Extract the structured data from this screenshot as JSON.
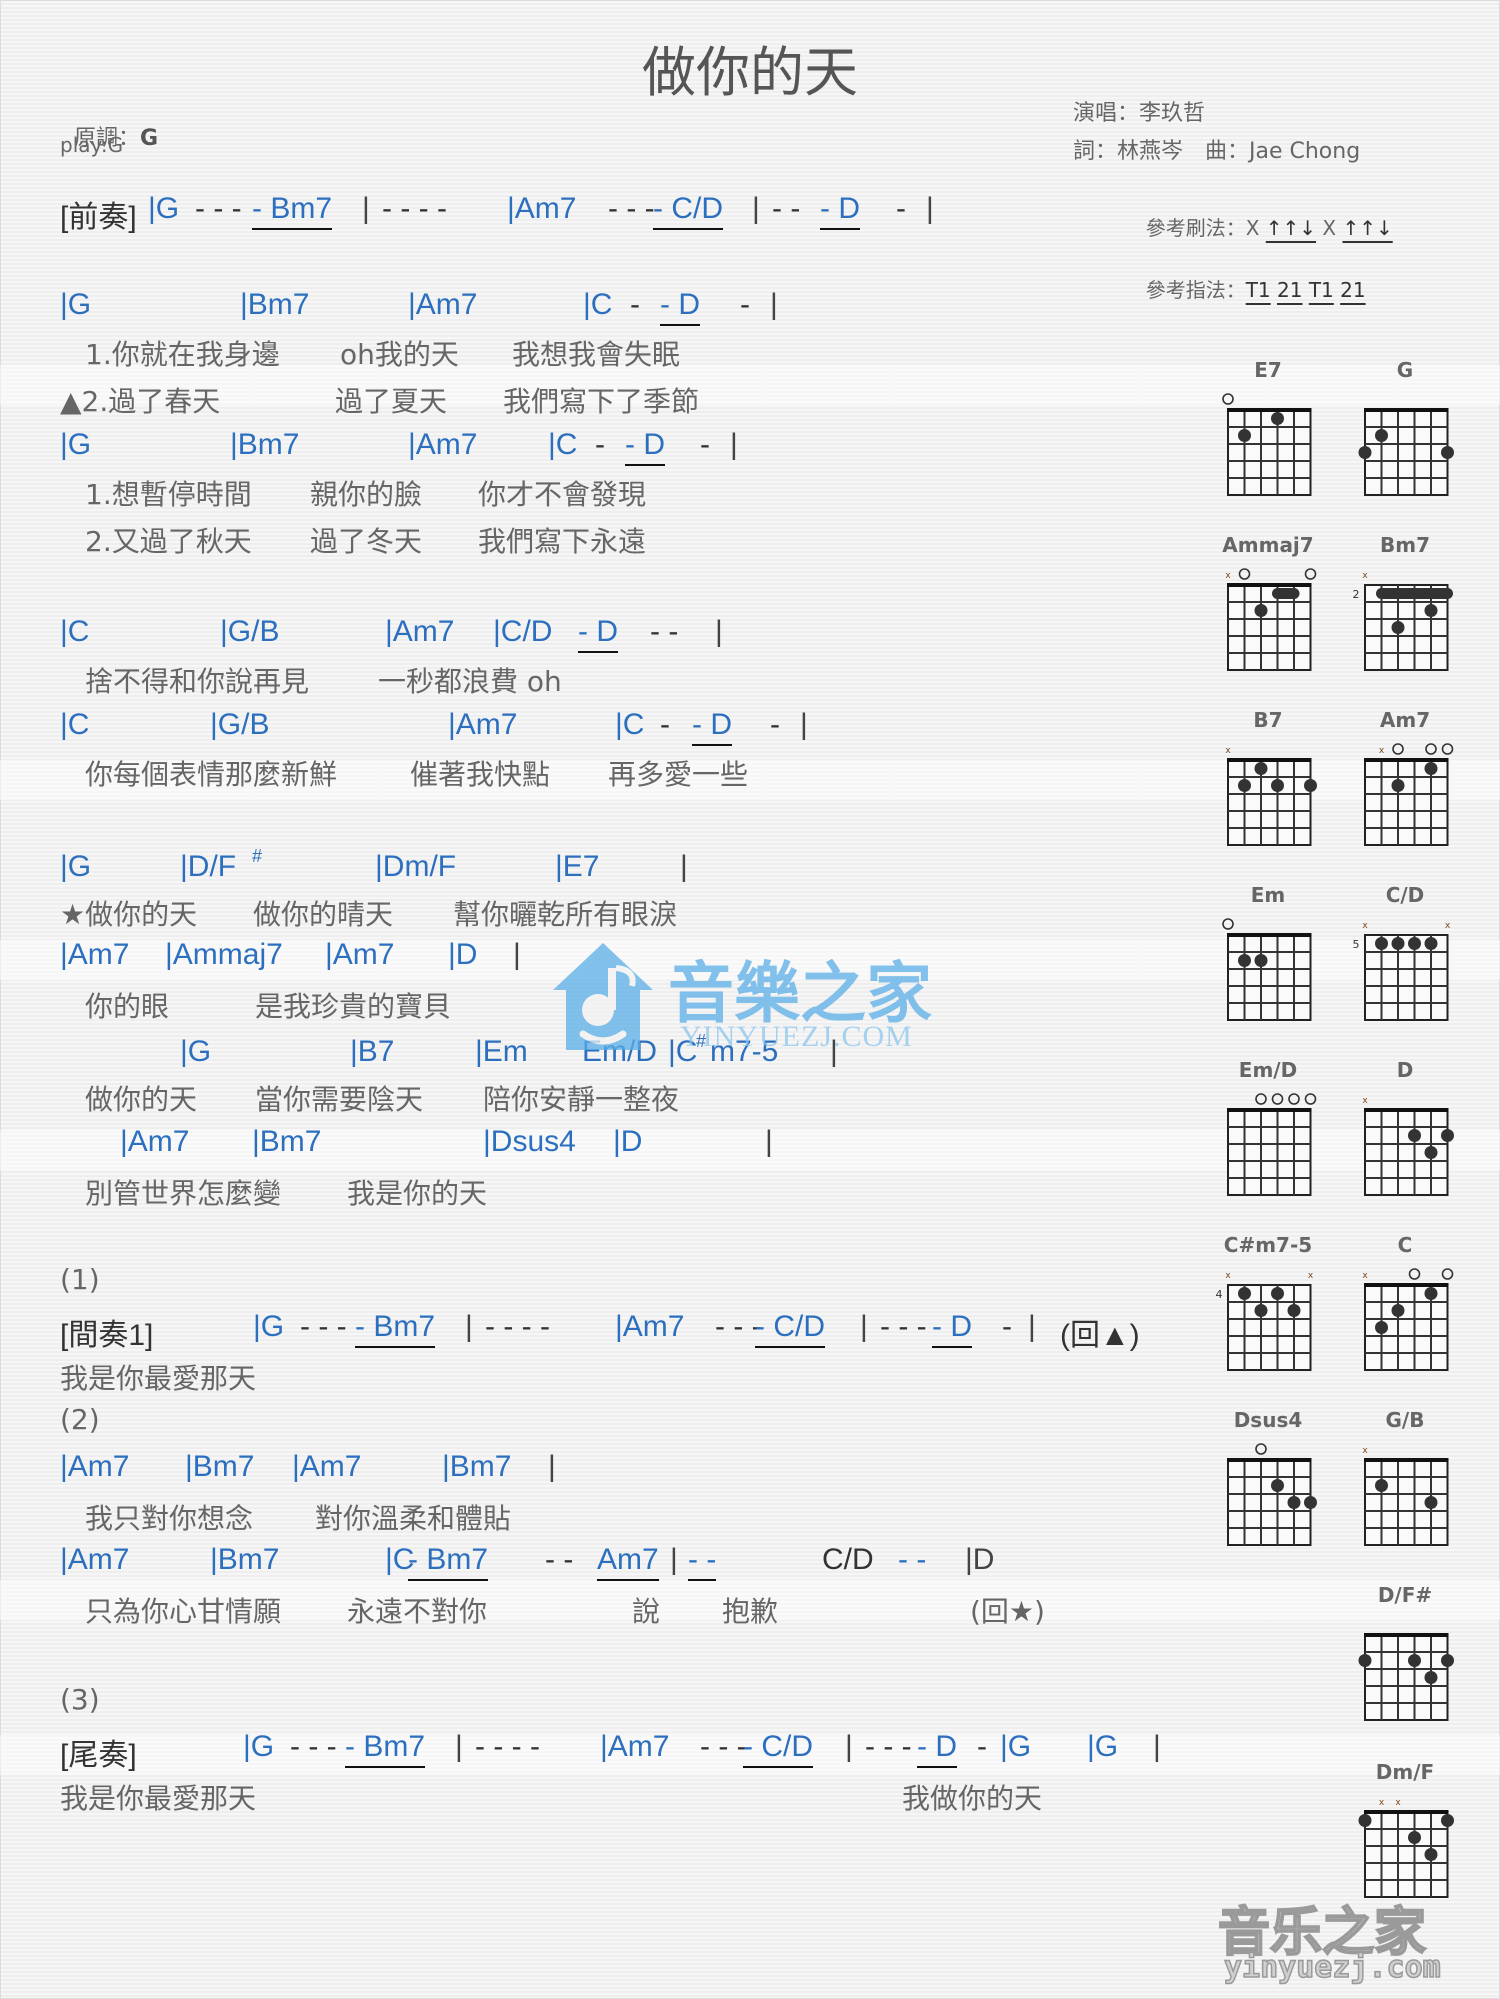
{
  "title": "做你的天",
  "meta": {
    "key_label": "原調：",
    "key_value": "G",
    "play": "play:G",
    "singer": "演唱：李玖哲",
    "credits": "詞：林燕岑　曲：Jae Chong",
    "strum_label": "參考刷法：",
    "strum_parts": [
      "X",
      "↑↑↓",
      "X",
      "↑↑↓"
    ],
    "finger_label": "參考指法：",
    "finger_parts": [
      "T1",
      "21",
      "T1",
      "21"
    ]
  },
  "sections": {
    "intro_label": "[前奏]",
    "interlude_label": "[間奏1]",
    "outro_label": "[尾奏]",
    "part1": "(1)",
    "part2": "(2)",
    "part3": "(3)",
    "back_triangle": "(回▲)",
    "back_star": "(回★)"
  },
  "lines": {
    "intro": [
      "|G",
      "- - -",
      "- Bm7",
      "|",
      "- - - -",
      "|Am7",
      "- - -",
      "- C/D",
      "|",
      "- -",
      "- D",
      "-",
      "|"
    ],
    "v1_chords": [
      "|G",
      "|Bm7",
      "|Am7",
      "|C",
      "-",
      "- D",
      "-",
      "|"
    ],
    "v1_lyric1": [
      "1.你就在我身邊",
      "oh我的天",
      "我想我會失眠"
    ],
    "v1_lyric2": [
      "▲2.過了春天",
      "過了夏天",
      "我們寫下了季節"
    ],
    "v2_chords": [
      "|G",
      "|Bm7",
      "|Am7",
      "|C",
      "-",
      "- D",
      "-",
      "|"
    ],
    "v2_lyric1": [
      "1.想暫停時間",
      "親你的臉",
      "你才不會發現"
    ],
    "v2_lyric2": [
      "2.又過了秋天",
      "過了冬天",
      "我們寫下永遠"
    ],
    "p1_chords": [
      "|C",
      "|G/B",
      "|Am7",
      "|C/D",
      "- D",
      "- -",
      "|"
    ],
    "p1_lyric": [
      "捨不得和你說再見",
      "一秒都浪費 oh"
    ],
    "p2_chords": [
      "|C",
      "|G/B",
      "|Am7",
      "|C",
      "-",
      "- D",
      "-",
      "|"
    ],
    "p2_lyric": [
      "你每個表情那麼新鮮",
      "催著我快點",
      "再多愛一些"
    ],
    "c1_chords": [
      "|G",
      "|D/F",
      "#",
      "|Dm/F",
      "|E7",
      "|"
    ],
    "c1_lyric": [
      "★做你的天",
      "做你的晴天",
      "幫你曬乾所有眼淚"
    ],
    "c2_chords": [
      "|Am7",
      "|Ammaj7",
      "|Am7",
      "|D",
      "|"
    ],
    "c2_lyric": [
      "你的眼",
      "是我珍貴的寶貝"
    ],
    "c3_chords": [
      "|G",
      "|B7",
      "|Em",
      "Em/D",
      "|C",
      "#",
      "m7-5",
      "|"
    ],
    "c3_lyric": [
      "做你的天",
      "當你需要陰天",
      "陪你安靜一整夜"
    ],
    "c4_chords": [
      "|Am7",
      "|Bm7",
      "|Dsus4",
      "|D",
      "|"
    ],
    "c4_lyric": [
      "別管世界怎麼變",
      "我是你的天"
    ],
    "interlude": [
      "|G",
      "- - -",
      "- Bm7",
      "|",
      "- - - -",
      "|Am7",
      "- - -",
      "- C/D",
      "|",
      "- - -",
      "- D",
      "-",
      "|"
    ],
    "interlude_lyric": "我是你最愛那天",
    "b1_chords": [
      "|Am7",
      "|Bm7",
      "|Am7",
      "|Bm7",
      "|"
    ],
    "b1_lyric": [
      "我只對你想念",
      "對你溫柔和體貼"
    ],
    "b2_chords": [
      "|Am7",
      "|Bm7",
      "|C",
      "- Bm7",
      "- -",
      "Am7",
      "|",
      "- -",
      "C/D",
      "- -",
      "|D",
      "|"
    ],
    "b2_lyric": [
      "只為你心甘情願",
      "永遠不對你",
      "說",
      "抱歉"
    ],
    "outro": [
      "|G",
      "- - -",
      "- Bm7",
      "|",
      "- - - -",
      "|Am7",
      "- - -",
      "- C/D",
      "|",
      "- - -",
      "- D",
      "-",
      "|G",
      "|G",
      "|"
    ],
    "outro_lyric": [
      "我是你最愛那天",
      "我做你的天"
    ]
  },
  "chord_diagrams": [
    {
      "name": "E7",
      "base_fret": null,
      "strings": [
        "o",
        "",
        "",
        "",
        "",
        ""
      ],
      "dots": [
        [
          2,
          2
        ],
        [
          4,
          1
        ]
      ],
      "barre": null
    },
    {
      "name": "G",
      "base_fret": null,
      "strings": [
        "",
        "",
        "",
        "",
        "",
        ""
      ],
      "dots": [
        [
          1,
          3
        ],
        [
          2,
          2
        ],
        [
          6,
          3
        ]
      ],
      "barre": null
    },
    {
      "name": "Ammaj7",
      "base_fret": null,
      "strings": [
        "x",
        "o",
        "",
        "",
        "",
        "o"
      ],
      "dots": [
        [
          3,
          2
        ]
      ],
      "barre": [
        4,
        5,
        1
      ]
    },
    {
      "name": "Bm7",
      "base_fret": "2",
      "strings": [
        "x",
        "",
        "",
        "",
        "",
        ""
      ],
      "dots": [
        [
          3,
          3
        ],
        [
          5,
          2
        ]
      ],
      "barre": [
        2,
        6,
        1
      ]
    },
    {
      "name": "B7",
      "base_fret": null,
      "strings": [
        "x",
        "",
        "",
        "",
        "",
        ""
      ],
      "dots": [
        [
          2,
          2
        ],
        [
          3,
          1
        ],
        [
          4,
          2
        ],
        [
          6,
          2
        ]
      ],
      "barre": null
    },
    {
      "name": "Am7",
      "base_fret": null,
      "strings": [
        "",
        "x",
        "o",
        "",
        "o",
        "o"
      ],
      "dots": [
        [
          3,
          2
        ],
        [
          5,
          1
        ]
      ],
      "barre": null
    },
    {
      "name": "Em",
      "base_fret": null,
      "strings": [
        "o",
        "",
        "",
        "",
        "",
        ""
      ],
      "dots": [
        [
          2,
          2
        ],
        [
          3,
          2
        ]
      ],
      "barre": null
    },
    {
      "name": "C/D",
      "base_fret": "5",
      "strings": [
        "x",
        "",
        "",
        "",
        "",
        "x"
      ],
      "dots": [
        [
          2,
          1
        ],
        [
          3,
          1
        ],
        [
          4,
          1
        ],
        [
          5,
          1
        ]
      ],
      "barre": null
    },
    {
      "name": "Em/D",
      "base_fret": null,
      "strings": [
        "",
        "",
        "o",
        "o",
        "o",
        "o"
      ],
      "dots": [],
      "barre": null
    },
    {
      "name": "D",
      "base_fret": null,
      "strings": [
        "x",
        "",
        "",
        "",
        "",
        ""
      ],
      "dots": [
        [
          4,
          2
        ],
        [
          5,
          3
        ],
        [
          6,
          2
        ]
      ],
      "barre": null
    },
    {
      "name": "C#m7-5",
      "base_fret": "4",
      "strings": [
        "x",
        "",
        "",
        "",
        "",
        "x"
      ],
      "dots": [
        [
          2,
          1
        ],
        [
          3,
          2
        ],
        [
          4,
          1
        ],
        [
          5,
          2
        ]
      ],
      "barre": null
    },
    {
      "name": "C",
      "base_fret": null,
      "strings": [
        "x",
        "",
        "",
        "o",
        "",
        "o"
      ],
      "dots": [
        [
          2,
          3
        ],
        [
          3,
          2
        ],
        [
          5,
          1
        ]
      ],
      "barre": null
    },
    {
      "name": "Dsus4",
      "base_fret": null,
      "strings": [
        "",
        "",
        "o",
        "",
        "",
        ""
      ],
      "dots": [
        [
          4,
          2
        ],
        [
          5,
          3
        ],
        [
          6,
          3
        ]
      ],
      "barre": null
    },
    {
      "name": "G/B",
      "base_fret": null,
      "strings": [
        "x",
        "",
        "",
        "",
        "",
        ""
      ],
      "dots": [
        [
          2,
          2
        ],
        [
          5,
          3
        ]
      ],
      "barre": null
    },
    {
      "name": "D/F#",
      "base_fret": null,
      "strings": [
        "",
        "",
        "",
        "",
        "",
        ""
      ],
      "dots": [
        [
          1,
          2
        ],
        [
          4,
          2
        ],
        [
          5,
          3
        ],
        [
          6,
          2
        ]
      ],
      "barre": null
    },
    {
      "name": "Dm/F",
      "base_fret": null,
      "strings": [
        "",
        "x",
        "x",
        "",
        "",
        ""
      ],
      "dots": [
        [
          1,
          1
        ],
        [
          4,
          2
        ],
        [
          5,
          3
        ],
        [
          6,
          1
        ]
      ],
      "barre": null
    }
  ],
  "watermark": {
    "center_text": "音樂之家",
    "center_sub": "YINYUEZJ.COM",
    "corner_text": "音乐之家",
    "corner_sub": "yinyuezj.com",
    "color": "#5aaee8"
  }
}
